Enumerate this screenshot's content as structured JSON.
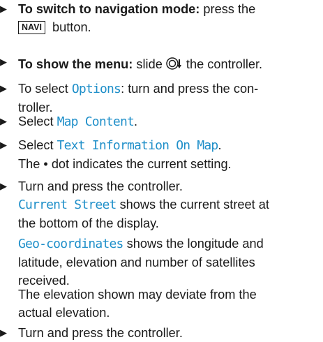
{
  "step1": {
    "bullet": "▶",
    "bold": "To switch to navigation mode:",
    "text1": " press the",
    "key": "NAVI",
    "text2": " button."
  },
  "step2": {
    "bullet": "▶",
    "bold": "To show the menu:",
    "text1": " slide ",
    "text2": " the controller."
  },
  "step3": {
    "bullet": "▶",
    "text1": "To select ",
    "mono": "Options",
    "text2": ": turn and press the con-",
    "line2": "troller."
  },
  "step4": {
    "bullet": "▶",
    "text1": "Select ",
    "mono": "Map Content",
    "text2": "."
  },
  "step5": {
    "bullet": "▶",
    "text1": "Select ",
    "mono": "Text Information On Map",
    "text2": ".",
    "line2": "The • dot indicates the current setting."
  },
  "step6": {
    "bullet": "▶",
    "text1": "Turn and press the controller.",
    "mono1": "Current Street",
    "desc1a": " shows the current street at",
    "desc1b": "the bottom of the display.",
    "mono2": "Geo-coordinates",
    "desc2a": " shows the longitude and",
    "desc2b": "latitude, elevation and number of satellites",
    "desc2c": "received.",
    "note1": "The elevation shown may deviate from the",
    "note2": "actual elevation."
  },
  "step7": {
    "bullet": "▶",
    "text1": "Turn and press the controller."
  }
}
